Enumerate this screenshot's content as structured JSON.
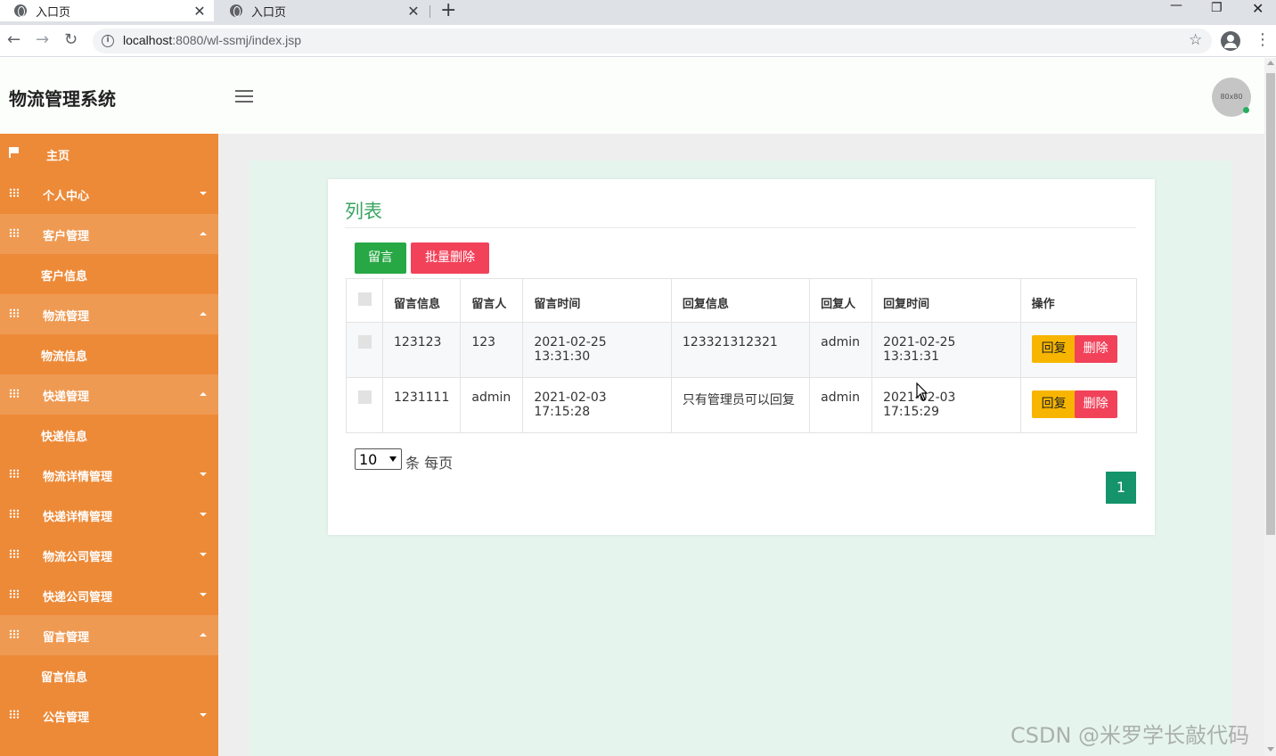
{
  "browser": {
    "tabs": [
      {
        "title": "入口页",
        "active": true
      },
      {
        "title": "入口页",
        "active": false
      }
    ],
    "url_host": "localhost",
    "url_rest": ":8080/wl-ssmj/index.jsp"
  },
  "header": {
    "app_title": "物流管理系统",
    "avatar_text": "80x80"
  },
  "sidebar": {
    "items": [
      {
        "label": "主页",
        "icon": "flag-icon",
        "type": "item"
      },
      {
        "label": "个人中心",
        "icon": "grid-icon",
        "type": "item",
        "expanded": false
      },
      {
        "label": "客户管理",
        "icon": "grid-icon",
        "type": "item",
        "expanded": true
      },
      {
        "label": "客户信息",
        "type": "sub"
      },
      {
        "label": "物流管理",
        "icon": "grid-icon",
        "type": "item",
        "expanded": true
      },
      {
        "label": "物流信息",
        "type": "sub"
      },
      {
        "label": "快递管理",
        "icon": "grid-icon",
        "type": "item",
        "expanded": true
      },
      {
        "label": "快递信息",
        "type": "sub"
      },
      {
        "label": "物流详情管理",
        "icon": "grid-icon",
        "type": "item",
        "expanded": false
      },
      {
        "label": "快递详情管理",
        "icon": "grid-icon",
        "type": "item",
        "expanded": false
      },
      {
        "label": "物流公司管理",
        "icon": "grid-icon",
        "type": "item",
        "expanded": false
      },
      {
        "label": "快递公司管理",
        "icon": "grid-icon",
        "type": "item",
        "expanded": false
      },
      {
        "label": "留言管理",
        "icon": "grid-icon",
        "type": "item",
        "expanded": true
      },
      {
        "label": "留言信息",
        "type": "sub"
      },
      {
        "label": "公告管理",
        "icon": "grid-icon",
        "type": "item",
        "expanded": false
      }
    ]
  },
  "main": {
    "card_title": "列表",
    "add_button": "留言",
    "batch_delete_button": "批量删除",
    "columns": [
      "留言信息",
      "留言人",
      "留言时间",
      "回复信息",
      "回复人",
      "回复时间",
      "操作"
    ],
    "rows": [
      {
        "message": "123123",
        "author": "123",
        "time": "2021-02-25 13:31:30",
        "reply": "123321312321",
        "replier": "admin",
        "reply_time": "2021-02-25 13:31:31"
      },
      {
        "message": "1231111",
        "author": "admin",
        "time": "2021-02-03 17:15:28",
        "reply": "只有管理员可以回复",
        "replier": "admin",
        "reply_time": "2021-02-03 17:15:29"
      }
    ],
    "reply_label": "回复",
    "delete_label": "删除",
    "page_size": "10",
    "page_size_suffix": "条 每页",
    "current_page": "1"
  },
  "watermark": "CSDN @米罗学长敲代码",
  "colors": {
    "sidebar": "#ed8a38",
    "accent_green": "#28a745",
    "danger": "#f2425a",
    "warning": "#f7b500",
    "title_green": "#3aa563"
  }
}
